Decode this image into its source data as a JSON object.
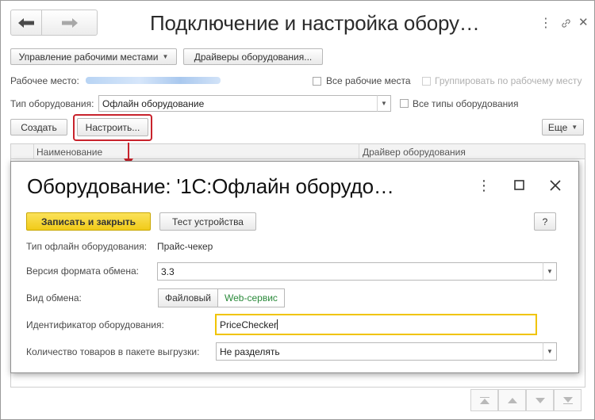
{
  "window": {
    "title": "Подключение и настройка обору…"
  },
  "toolbar": {
    "workplaces_label": "Управление рабочими местами",
    "drivers_label": "Драйверы оборудования..."
  },
  "filters": {
    "workplace_label": "Рабочее место:",
    "all_workplaces_label": "Все рабочие места",
    "group_by_workplace_label": "Группировать по рабочему месту",
    "equipment_type_label": "Тип оборудования:",
    "equipment_type_value": "Офлайн оборудование",
    "all_types_label": "Все типы оборудования"
  },
  "actions": {
    "create_label": "Создать",
    "configure_label": "Настроить...",
    "more_label": "Еще"
  },
  "table": {
    "columns": [
      "Наименование",
      "Драйвер оборудования"
    ]
  },
  "dialog": {
    "title": "Оборудование: '1С:Офлайн оборудо…",
    "save_close_label": "Записать и закрыть",
    "test_label": "Тест устройства",
    "help_label": "?",
    "offline_type_label": "Тип офлайн оборудования:",
    "offline_type_value": "Прайс-чекер",
    "format_version_label": "Версия формата обмена:",
    "format_version_value": "3.3",
    "exchange_type_label": "Вид обмена:",
    "exchange_options": [
      "Файловый",
      "Web-сервис"
    ],
    "exchange_selected": "Web-сервис",
    "device_id_label": "Идентификатор оборудования:",
    "device_id_value": "PriceChecker",
    "batch_count_label": "Количество товаров в пакете выгрузки:",
    "batch_count_value": "Не разделять"
  },
  "colors": {
    "highlight": "#c8232c",
    "primary_button": "#f1cb19",
    "selected_option": "#2a8a3a",
    "active_input_border": "#f0c400"
  }
}
